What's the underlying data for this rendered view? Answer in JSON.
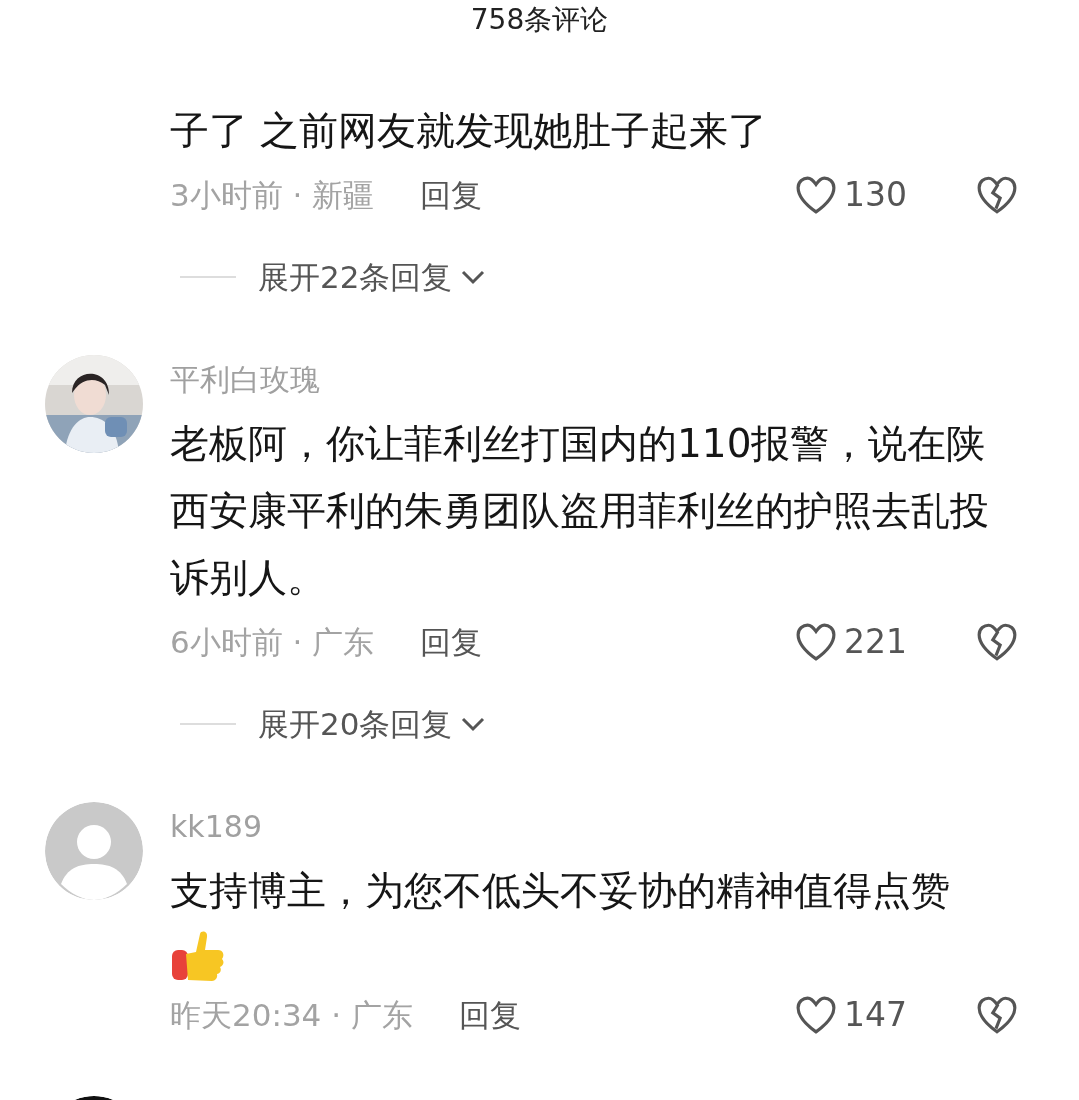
{
  "header": {
    "title": "758条评论"
  },
  "comments": [
    {
      "text": "子了 之前网友就发现她肚子起来了",
      "time_location": "3小时前 · 新疆",
      "reply": "回复",
      "likes": "130",
      "expand": "展开22条回复"
    },
    {
      "author": "平利白玫瑰",
      "text": "老板阿，你让菲利丝打国内的110报警，说在陕西安康平利的朱勇团队盗用菲利丝的护照去乱投诉别人。",
      "time_location": "6小时前 · 广东",
      "reply": "回复",
      "likes": "221",
      "expand": "展开20条回复"
    },
    {
      "avatar": {
        "kind": "default"
      },
      "author": "kk189",
      "text": "支持博主，为您不低头不妥协的精神值得点赞",
      "emoji": {
        "kind": "thumbs-up"
      },
      "time_location": "昨天20:34 · 广东",
      "reply": "回复",
      "likes": "147"
    },
    {
      "avatar": {
        "kind": "dark"
      }
    }
  ]
}
